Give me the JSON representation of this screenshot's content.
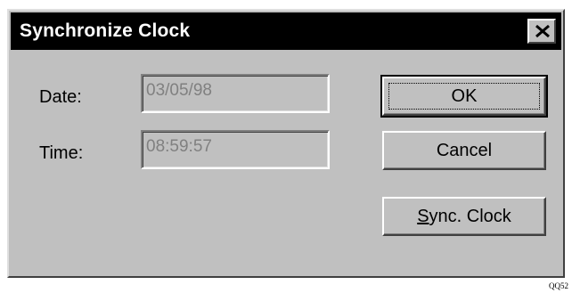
{
  "window": {
    "title": "Synchronize Clock",
    "close_icon": "close-icon"
  },
  "fields": {
    "date_label": "Date:",
    "date_value": "03/05/98",
    "time_label": "Time:",
    "time_value": "08:59:57"
  },
  "buttons": {
    "ok_label": "OK",
    "cancel_label": "Cancel",
    "sync_mnemonic": "S",
    "sync_rest": "ync. Clock"
  },
  "footnote": "QQ52"
}
